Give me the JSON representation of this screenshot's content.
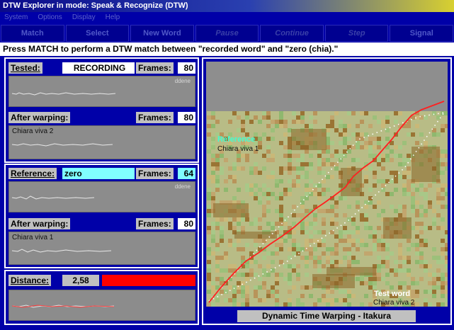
{
  "window": {
    "title": "DTW Explorer in mode: Speak & Recognize (DTW)"
  },
  "menu": [
    "System",
    "Options",
    "Display",
    "Help"
  ],
  "toolbar": {
    "buttons": [
      {
        "label": "Match",
        "enabled": true
      },
      {
        "label": "Select Reference",
        "enabled": true
      },
      {
        "label": "New Word",
        "enabled": true
      },
      {
        "label": "Pause",
        "enabled": false
      },
      {
        "label": "Continue",
        "enabled": false
      },
      {
        "label": "Step",
        "enabled": false
      },
      {
        "label": "Signal",
        "enabled": true
      }
    ]
  },
  "status_message": "Press MATCH to perform a DTW match between \"recorded word\" and \"zero (chia).\"",
  "tested": {
    "label": "Tested:",
    "value": "RECORDING",
    "frames_label": "Frames:",
    "frames": "80",
    "speaker": "ddene"
  },
  "tested_warp": {
    "label": "After warping:",
    "frames_label": "Frames:",
    "frames": "80",
    "caption": "Chiara viva 2"
  },
  "reference": {
    "label": "Reference:",
    "value": "zero",
    "frames_label": "Frames:",
    "frames": "64",
    "speaker": "ddene"
  },
  "reference_warp": {
    "label": "After warping:",
    "frames_label": "Frames:",
    "frames": "80",
    "caption": "Chiara viva 1"
  },
  "distance": {
    "label": "Distance:",
    "value": "2,58",
    "bar_color": "#ff0000"
  },
  "dtw_plot": {
    "reference_label": "Reference",
    "reference_caption": "Chiara viva 1",
    "test_label": "Test word",
    "test_caption": "Chiara viva 2",
    "caption": "Dynamic Time Warping - Itakura",
    "path_color": "#ff2020",
    "bound_color": "#ffffff"
  },
  "colors": {
    "background": "#0000a8",
    "panel_label": "#c0c0c0",
    "input_highlight": "#80ffff",
    "waveform_area": "#8c8c8c"
  }
}
